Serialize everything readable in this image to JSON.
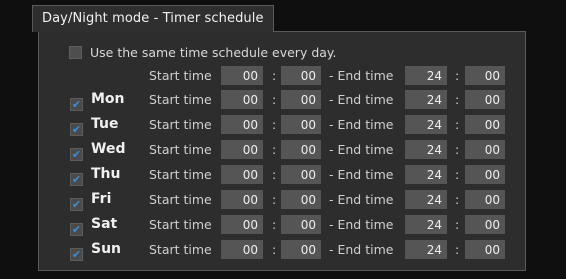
{
  "window": {
    "title": "Day/Night mode - Timer schedule"
  },
  "same_schedule": {
    "label": "Use the same time schedule every day.",
    "checked": false
  },
  "labels": {
    "start": "Start time",
    "end": "- End time",
    "colon": ":"
  },
  "all_days": {
    "start_h": "00",
    "start_m": "00",
    "end_h": "24",
    "end_m": "00"
  },
  "days": [
    {
      "name": "Mon",
      "checked": true,
      "start_h": "00",
      "start_m": "00",
      "end_h": "24",
      "end_m": "00"
    },
    {
      "name": "Tue",
      "checked": true,
      "start_h": "00",
      "start_m": "00",
      "end_h": "24",
      "end_m": "00"
    },
    {
      "name": "Wed",
      "checked": true,
      "start_h": "00",
      "start_m": "00",
      "end_h": "24",
      "end_m": "00"
    },
    {
      "name": "Thu",
      "checked": true,
      "start_h": "00",
      "start_m": "00",
      "end_h": "24",
      "end_m": "00"
    },
    {
      "name": "Fri",
      "checked": true,
      "start_h": "00",
      "start_m": "00",
      "end_h": "24",
      "end_m": "00"
    },
    {
      "name": "Sat",
      "checked": true,
      "start_h": "00",
      "start_m": "00",
      "end_h": "24",
      "end_m": "00"
    },
    {
      "name": "Sun",
      "checked": true,
      "start_h": "00",
      "start_m": "00",
      "end_h": "24",
      "end_m": "00"
    }
  ],
  "colors": {
    "check_mark": "#3a8fd9",
    "field_bg": "#555555",
    "panel_bg": "#2d2d2d"
  }
}
